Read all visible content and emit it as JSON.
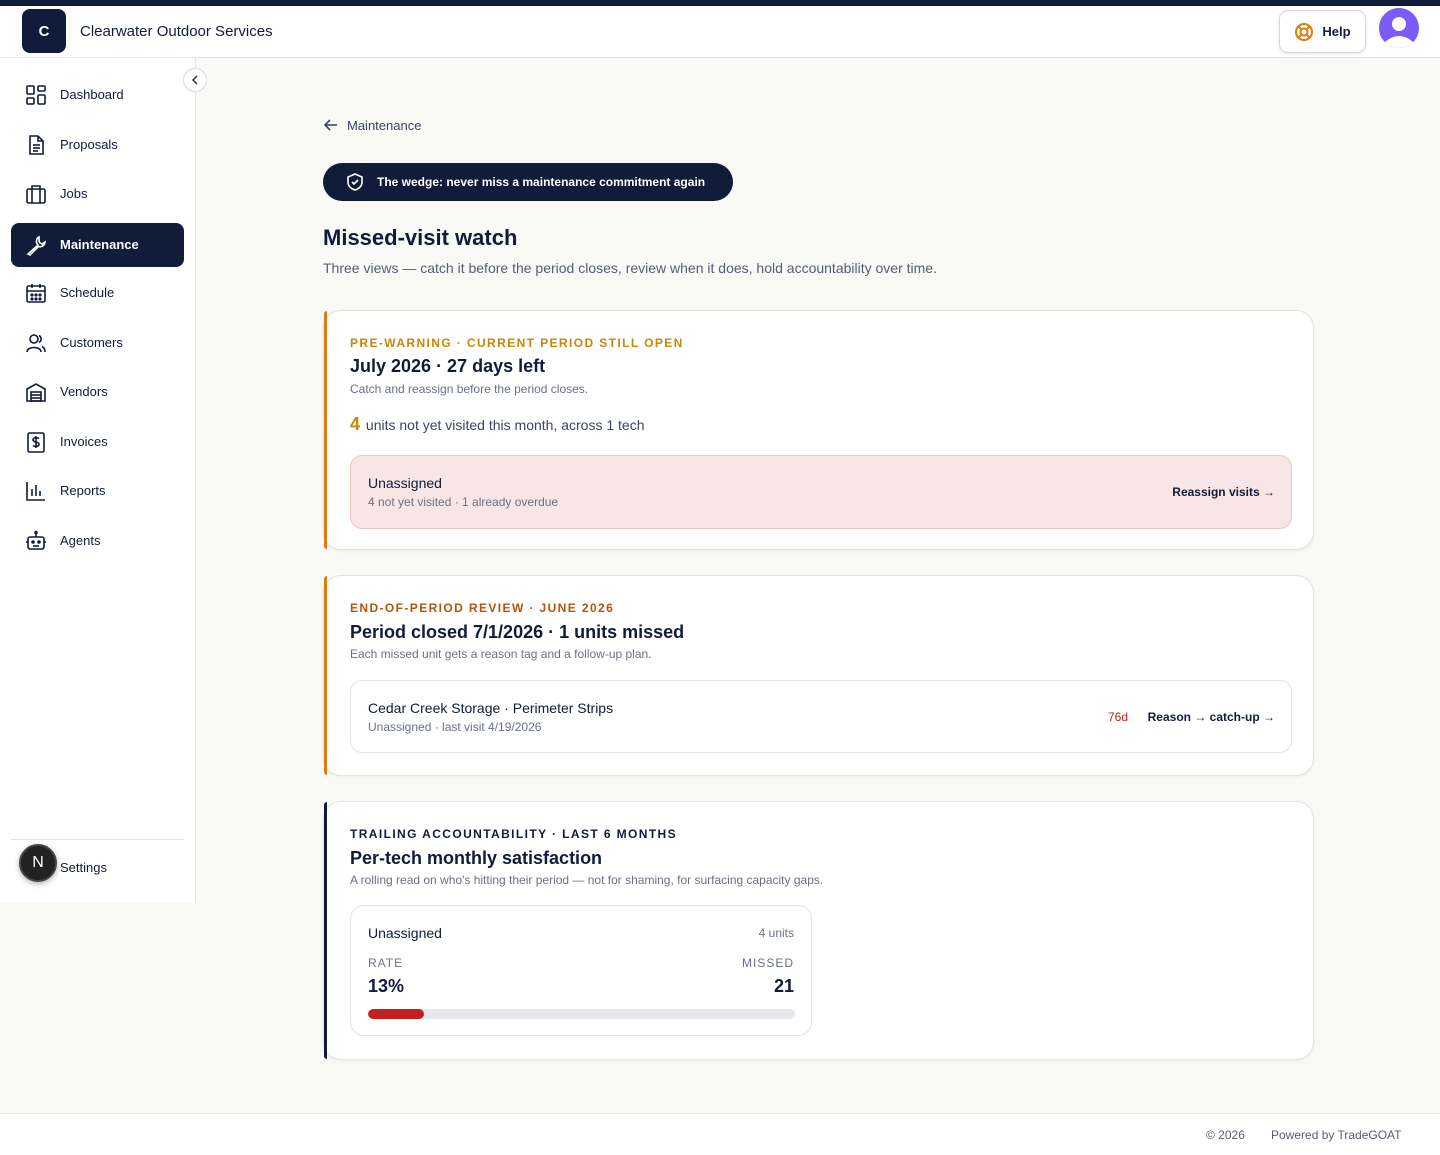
{
  "header": {
    "logo_letter": "C",
    "company": "Clearwater Outdoor Services",
    "help_label": "Help"
  },
  "sidebar": {
    "items": [
      {
        "label": "Dashboard",
        "icon": "grid-icon"
      },
      {
        "label": "Proposals",
        "icon": "document-icon"
      },
      {
        "label": "Jobs",
        "icon": "briefcase-icon"
      },
      {
        "label": "Maintenance",
        "icon": "wrench-icon",
        "active": true
      },
      {
        "label": "Schedule",
        "icon": "calendar-icon"
      },
      {
        "label": "Customers",
        "icon": "users-icon"
      },
      {
        "label": "Vendors",
        "icon": "warehouse-icon"
      },
      {
        "label": "Invoices",
        "icon": "dollar-receipt-icon"
      },
      {
        "label": "Reports",
        "icon": "bar-chart-icon"
      },
      {
        "label": "Agents",
        "icon": "robot-icon"
      }
    ],
    "settings_label": "Settings",
    "badge_letter": "N"
  },
  "main": {
    "back_label": "Maintenance",
    "wedge_text": "The wedge: never miss a maintenance commitment again",
    "title": "Missed-visit watch",
    "subtitle": "Three views — catch it before the period closes, review when it does, hold accountability over time.",
    "prewarning": {
      "kicker": "PRE-WARNING · CURRENT PERIOD STILL OPEN",
      "title": "July 2026 · 27 days left",
      "sub": "Catch and reassign before the period closes.",
      "count": "4",
      "count_text": "units not yet visited this month, across 1 tech",
      "row_title": "Unassigned",
      "row_sub": "4 not yet visited · 1 already overdue",
      "action": "Reassign visits →"
    },
    "review": {
      "kicker": "END-OF-PERIOD REVIEW · JUNE 2026",
      "title": "Period closed 7/1/2026 · 1 units missed",
      "sub": "Each missed unit gets a reason tag and a follow-up plan.",
      "row_title": "Cedar Creek Storage · Perimeter Strips",
      "row_sub": "Unassigned · last visit 4/19/2026",
      "days": "76d",
      "action": "Reason → catch-up →"
    },
    "trailing": {
      "kicker": "TRAILING ACCOUNTABILITY · LAST 6 MONTHS",
      "title": "Per-tech monthly satisfaction",
      "sub": "A rolling read on who's hitting their period — not for shaming, for surfacing capacity gaps.",
      "tech_name": "Unassigned",
      "units": "4 units",
      "rate_label": "RATE",
      "rate_value": "13%",
      "rate_fraction": 0.13,
      "missed_label": "MISSED",
      "missed_value": "21"
    }
  },
  "footer": {
    "copyright": "© 2026",
    "powered": "Powered by TradeGOAT"
  },
  "colors": {
    "navy": "#111b3a",
    "amber": "#c8860a",
    "orange_accent": "#e07b0f",
    "red": "#c42020",
    "pink_bg": "#f8e6e6"
  }
}
